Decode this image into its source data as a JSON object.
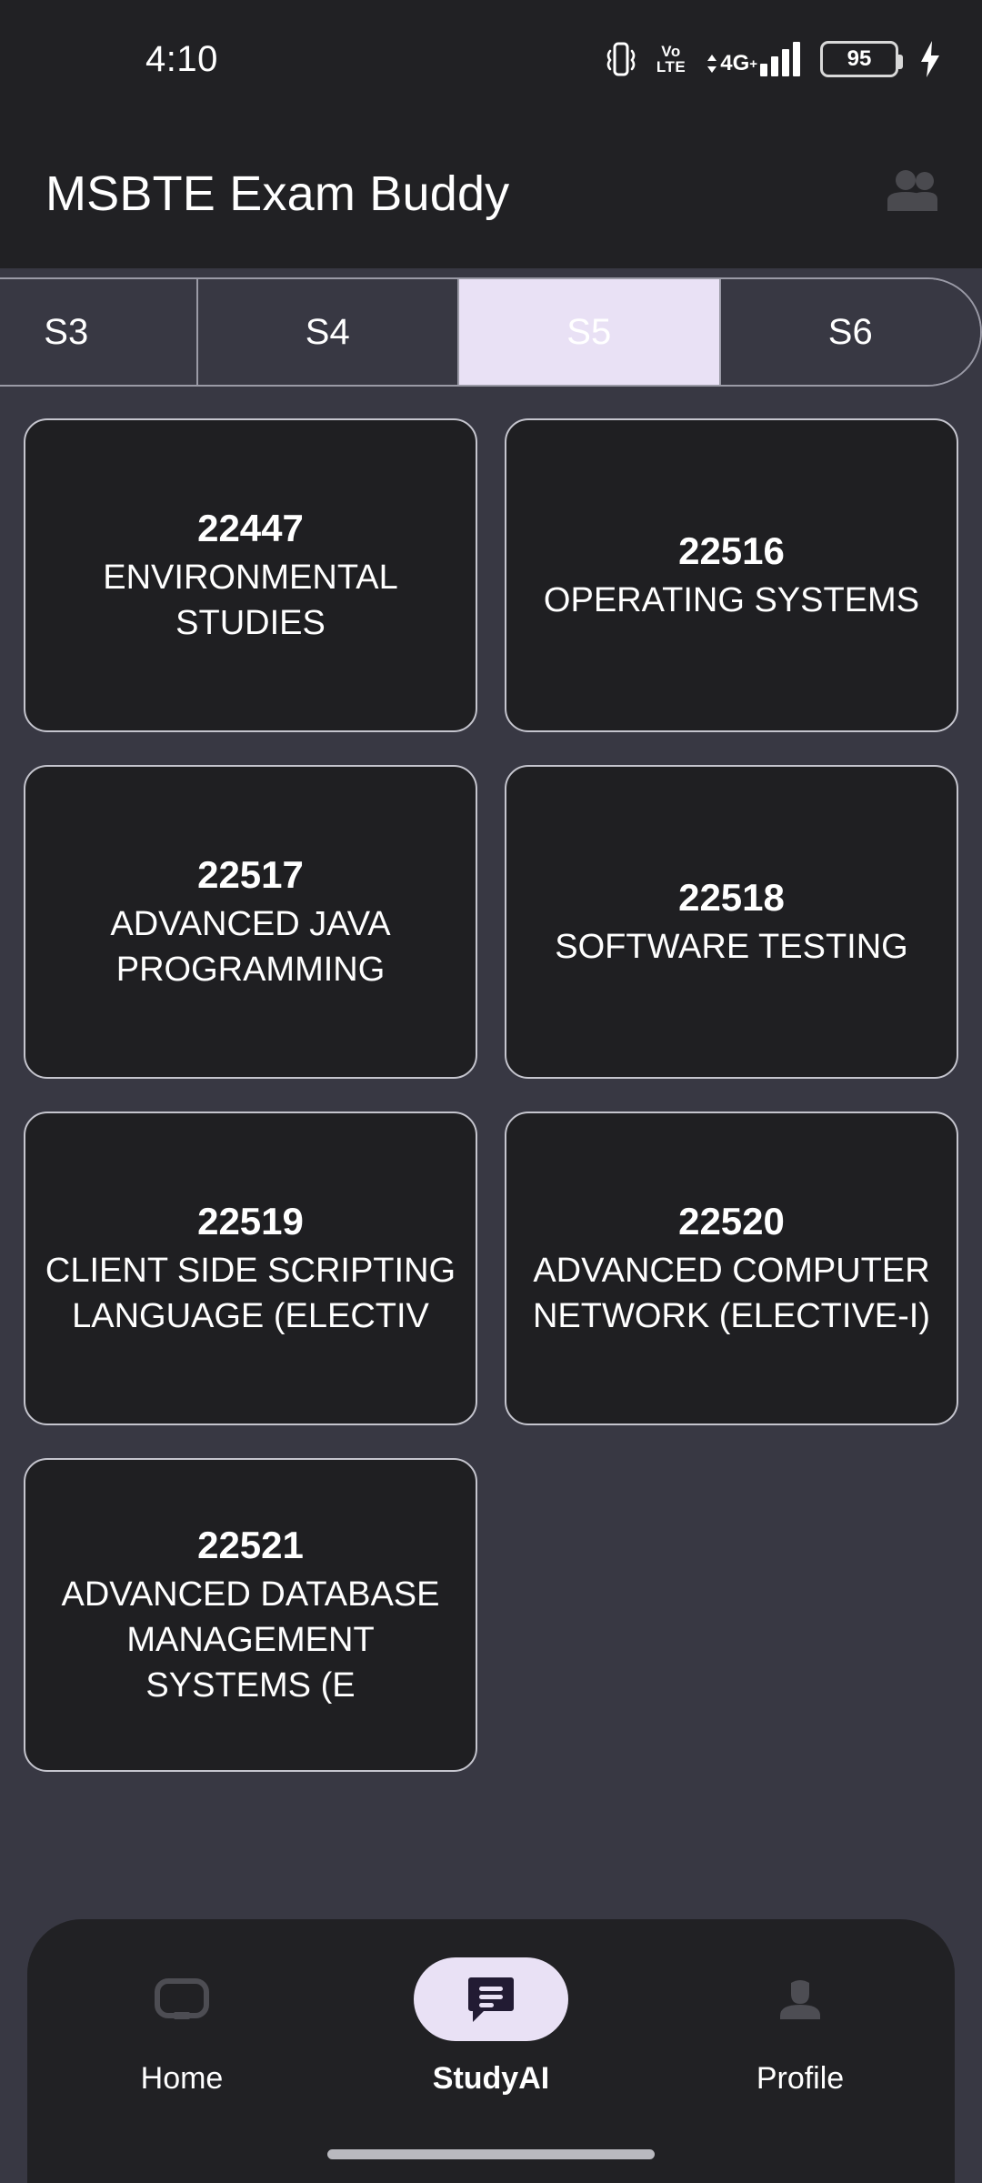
{
  "status_bar": {
    "time": "4:10",
    "icons": [
      "vibrate-icon",
      "volte-icon",
      "signal-4g-plus-icon",
      "battery-icon",
      "charging-bolt-icon"
    ],
    "volte_top": "Vo",
    "volte_bottom": "LTE",
    "network_label": "4G",
    "network_plus": "+",
    "battery_level": "95"
  },
  "app_bar": {
    "title": "MSBTE Exam Buddy",
    "action_icon": "group-people-icon"
  },
  "tabs": {
    "items": [
      {
        "label": "S3",
        "selected": false
      },
      {
        "label": "S4",
        "selected": false
      },
      {
        "label": "S5",
        "selected": true
      },
      {
        "label": "S6",
        "selected": false
      }
    ],
    "selected_color": "#E9E1F5"
  },
  "subjects": [
    {
      "code": "22447",
      "name": "ENVIRONMENTAL STUDIES"
    },
    {
      "code": "22516",
      "name": "OPERATING SYSTEMS"
    },
    {
      "code": "22517",
      "name": "ADVANCED JAVA PROGRAMMING"
    },
    {
      "code": "22518",
      "name": "SOFTWARE TESTING"
    },
    {
      "code": "22519",
      "name": "CLIENT SIDE SCRIPTING LANGUAGE (ELECTIV"
    },
    {
      "code": "22520",
      "name": "ADVANCED COMPUTER NETWORK (ELECTIVE-I)"
    },
    {
      "code": "22521",
      "name": "ADVANCED DATABASE MANAGEMENT SYSTEMS (E"
    }
  ],
  "bottom_nav": {
    "items": [
      {
        "label": "Home",
        "icon": "home-icon",
        "active": false
      },
      {
        "label": "StudyAI",
        "icon": "chat-message-icon",
        "active": true
      },
      {
        "label": "Profile",
        "icon": "person-icon",
        "active": false
      }
    ],
    "accent_color": "#E9E1F5"
  }
}
